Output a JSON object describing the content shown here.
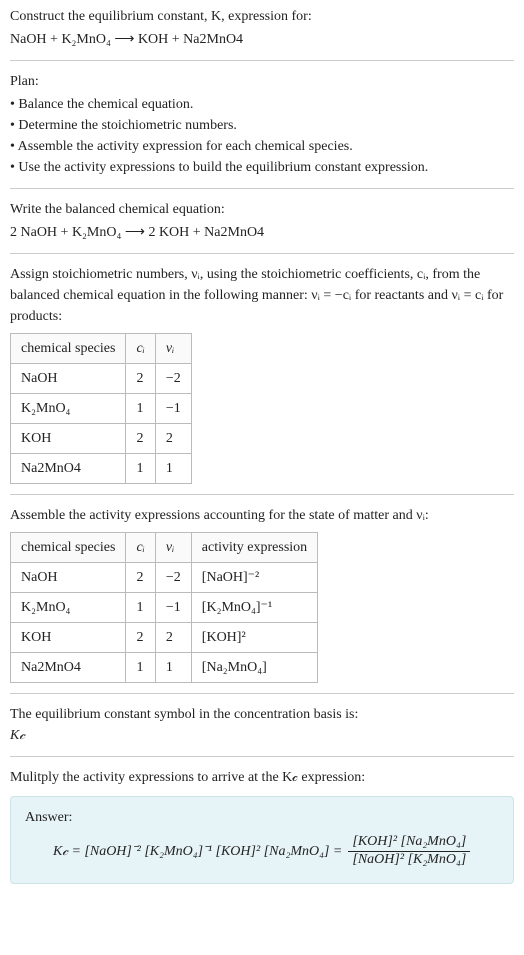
{
  "prompt_line1": "Construct the equilibrium constant, K, expression for:",
  "unbalanced_eq": "NaOH + K₂MnO₄ ⟶ KOH + Na2MnO4",
  "plan_head": "Plan:",
  "plan_items": [
    "Balance the chemical equation.",
    "Determine the stoichiometric numbers.",
    "Assemble the activity expression for each chemical species.",
    "Use the activity expressions to build the equilibrium constant expression."
  ],
  "balanced_head": "Write the balanced chemical equation:",
  "balanced_eq": "2 NaOH + K₂MnO₄ ⟶ 2 KOH + Na2MnO4",
  "assign_text": "Assign stoichiometric numbers, νᵢ, using the stoichiometric coefficients, cᵢ, from the balanced chemical equation in the following manner: νᵢ = −cᵢ for reactants and νᵢ = cᵢ for products:",
  "table1": {
    "headers": [
      "chemical species",
      "cᵢ",
      "νᵢ"
    ],
    "rows": [
      [
        "NaOH",
        "2",
        "−2"
      ],
      [
        "K₂MnO₄",
        "1",
        "−1"
      ],
      [
        "KOH",
        "2",
        "2"
      ],
      [
        "Na2MnO4",
        "1",
        "1"
      ]
    ]
  },
  "assemble_text": "Assemble the activity expressions accounting for the state of matter and νᵢ:",
  "table2": {
    "headers": [
      "chemical species",
      "cᵢ",
      "νᵢ",
      "activity expression"
    ],
    "rows": [
      [
        "NaOH",
        "2",
        "−2",
        "[NaOH]⁻²"
      ],
      [
        "K₂MnO₄",
        "1",
        "−1",
        "[K₂MnO₄]⁻¹"
      ],
      [
        "KOH",
        "2",
        "2",
        "[KOH]²"
      ],
      [
        "Na2MnO4",
        "1",
        "1",
        "[Na₂MnO₄]"
      ]
    ]
  },
  "symbol_text": "The equilibrium constant symbol in the concentration basis is:",
  "symbol_value": "K𝒸",
  "multiply_text": "Mulitply the activity expressions to arrive at the K𝒸 expression:",
  "answer_label": "Answer:",
  "kc_lhs": "K𝒸 = [NaOH]⁻² [K₂MnO₄]⁻¹ [KOH]² [Na₂MnO₄] =",
  "kc_frac_num": "[KOH]² [Na₂MnO₄]",
  "kc_frac_den": "[NaOH]² [K₂MnO₄]",
  "chart_data": {
    "type": "table",
    "tables": [
      {
        "title": "Stoichiometric numbers",
        "columns": [
          "chemical species",
          "c_i",
          "nu_i"
        ],
        "rows": [
          {
            "chemical species": "NaOH",
            "c_i": 2,
            "nu_i": -2
          },
          {
            "chemical species": "K2MnO4",
            "c_i": 1,
            "nu_i": -1
          },
          {
            "chemical species": "KOH",
            "c_i": 2,
            "nu_i": 2
          },
          {
            "chemical species": "Na2MnO4",
            "c_i": 1,
            "nu_i": 1
          }
        ]
      },
      {
        "title": "Activity expressions",
        "columns": [
          "chemical species",
          "c_i",
          "nu_i",
          "activity expression"
        ],
        "rows": [
          {
            "chemical species": "NaOH",
            "c_i": 2,
            "nu_i": -2,
            "activity expression": "[NaOH]^-2"
          },
          {
            "chemical species": "K2MnO4",
            "c_i": 1,
            "nu_i": -1,
            "activity expression": "[K2MnO4]^-1"
          },
          {
            "chemical species": "KOH",
            "c_i": 2,
            "nu_i": 2,
            "activity expression": "[KOH]^2"
          },
          {
            "chemical species": "Na2MnO4",
            "c_i": 1,
            "nu_i": 1,
            "activity expression": "[Na2MnO4]"
          }
        ]
      }
    ],
    "equilibrium_constant": "Kc = ([KOH]^2 [Na2MnO4]) / ([NaOH]^2 [K2MnO4])"
  }
}
